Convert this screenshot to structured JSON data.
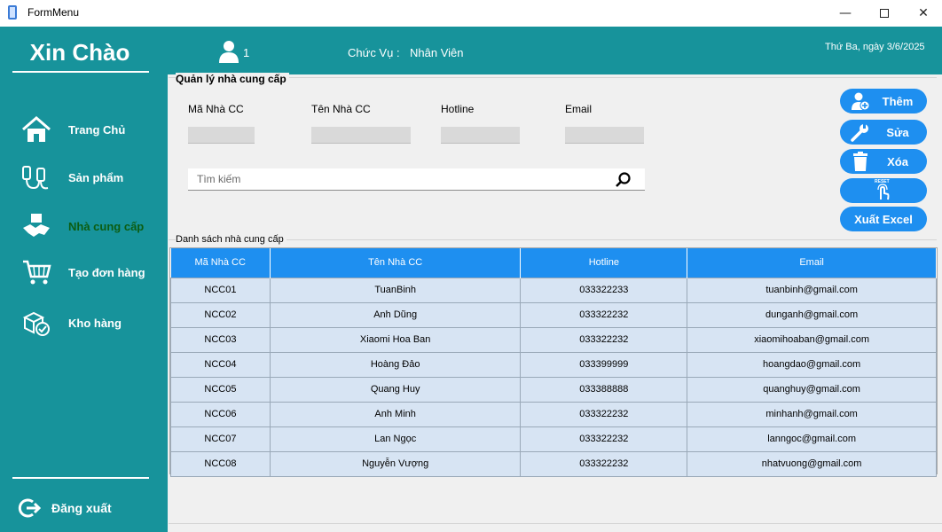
{
  "window": {
    "title": "FormMenu",
    "minimize": "—",
    "close": "✕"
  },
  "sidebar": {
    "greeting": "Xin Chào",
    "items": [
      {
        "label": "Trang Chủ",
        "icon": "home-icon"
      },
      {
        "label": "Sản phẩm",
        "icon": "product-icon"
      },
      {
        "label": "Nhà cung cấp",
        "icon": "supplier-icon",
        "active": true
      },
      {
        "label": "Tạo đơn hàng",
        "icon": "cart-icon"
      },
      {
        "label": "Kho hàng",
        "icon": "warehouse-icon"
      }
    ],
    "logout": "Đăng xuất"
  },
  "header": {
    "user_number": "1",
    "role_label": "Chức Vụ :",
    "role_value": "Nhân Viên",
    "date": "Thứ Ba, ngày 3/6/2025"
  },
  "manage": {
    "title": "Quản lý nhà cung cấp",
    "fields": [
      {
        "label": "Mã Nhà CC",
        "value": ""
      },
      {
        "label": "Tên Nhà CC",
        "value": ""
      },
      {
        "label": "Hotline",
        "value": ""
      },
      {
        "label": "Email",
        "value": ""
      }
    ],
    "search_placeholder": "Tìm kiếm",
    "buttons": {
      "add": "Thêm",
      "edit": "Sửa",
      "delete": "Xóa",
      "reset": "RESET",
      "export": "Xuất Excel"
    }
  },
  "list": {
    "title": "Danh sách nhà cung cấp",
    "columns": [
      "Mã Nhà CC",
      "Tên Nhà CC",
      "Hotline",
      "Email"
    ],
    "rows": [
      [
        "NCC01",
        "TuanBinh",
        "033322233",
        "tuanbinh@gmail.com"
      ],
      [
        "NCC02",
        "Anh Dũng",
        "033322232",
        "dunganh@gmail.com"
      ],
      [
        "NCC03",
        "Xiaomi Hoa Ban",
        "033322232",
        "xiaomihoaban@gmail.com"
      ],
      [
        "NCC04",
        "Hoàng Đảo",
        "033399999",
        "hoangdao@gmail.com"
      ],
      [
        "NCC05",
        "Quang Huy",
        "033388888",
        "quanghuy@gmail.com"
      ],
      [
        "NCC06",
        "Anh Minh",
        "033322232",
        "minhanh@gmail.com"
      ],
      [
        "NCC07",
        "Lan Ngọc",
        "033322232",
        "lanngoc@gmail.com"
      ],
      [
        "NCC08",
        "Nguyễn Vượng",
        "033322232",
        "nhatvuong@gmail.com"
      ]
    ]
  },
  "colors": {
    "sidebar": "#17939b",
    "accent": "#1e8ff0",
    "row": "#d7e4f3",
    "active_nav": "#0b5d12"
  }
}
